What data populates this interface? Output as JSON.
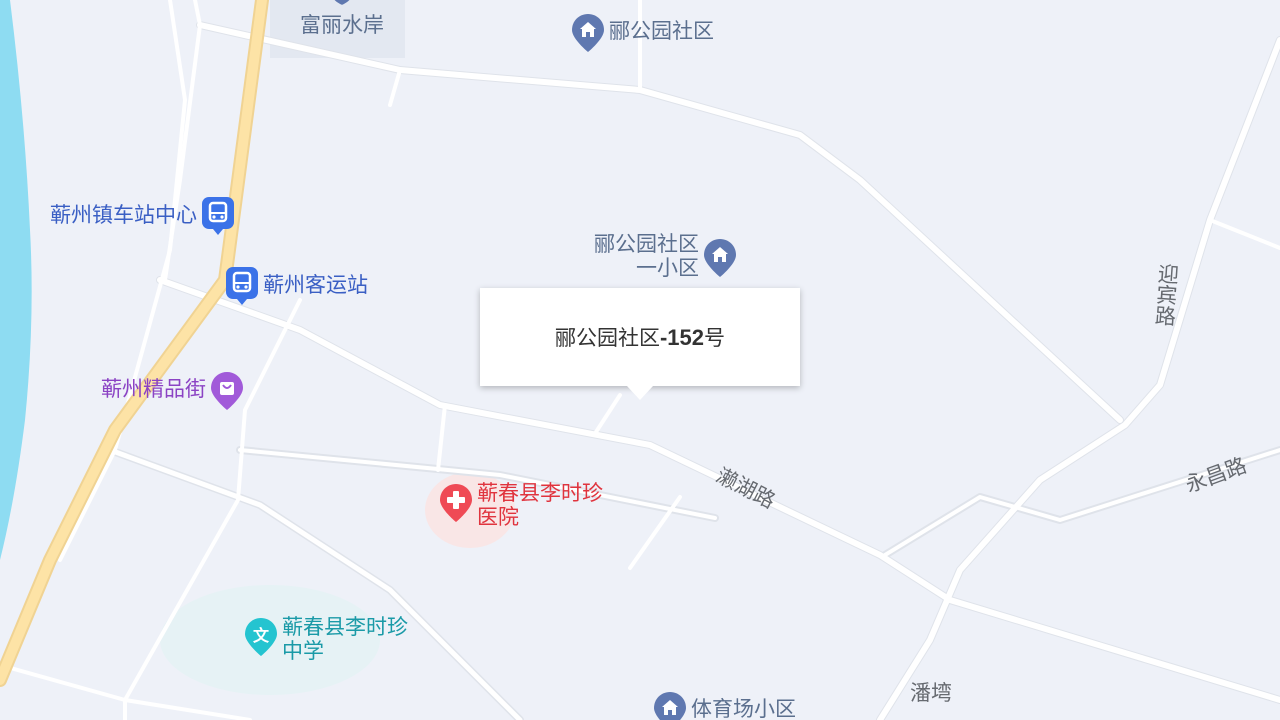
{
  "popup": {
    "prefix": "郦公园社区",
    "suffix": "-152",
    "unit": "号"
  },
  "pois": {
    "fulishuian": "富丽水岸",
    "ligongyuan": "郦公园社区",
    "bus_center": "蕲州镇车站中心",
    "bus_station": "蕲州客运站",
    "ligongyuan_sub": [
      "郦公园社区",
      "一小区"
    ],
    "boutique_street": "蕲州精品街",
    "hospital": [
      "蕲春县李时珍",
      "医院"
    ],
    "school": [
      "蕲春县李时珍",
      "中学"
    ],
    "stadium_area": "体育场小区"
  },
  "roads": {
    "yingbin": "迎宾路",
    "yongchang": "永昌路",
    "laihu": "濑湖路",
    "panwan": "潘塆"
  },
  "icons": {
    "community": "building-icon",
    "bus": "bus-icon",
    "shopping": "shopping-bag-icon",
    "hospital": "medical-cross-icon",
    "school": "school-icon"
  },
  "colors": {
    "land": "#eef1f8",
    "water": "#8edcf2",
    "major_road": "#fde3a6",
    "road": "#ffffff",
    "community_pin": "#5f78b0",
    "bus_pin": "#3b72e8",
    "shopping_pin": "#a15ad9",
    "hospital_pin": "#ef4a55",
    "school_pin": "#24c4d0"
  }
}
